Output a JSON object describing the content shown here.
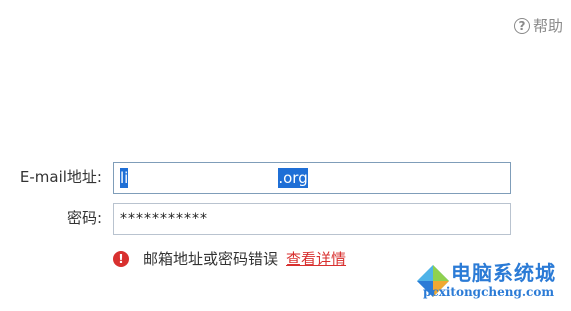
{
  "help": {
    "icon": "question-circle-icon",
    "label": "帮助"
  },
  "form": {
    "email_label": "E-mail地址:",
    "email_value_prefix": "li",
    "email_value_suffix": ".org",
    "password_label": "密码:",
    "password_value": "***********"
  },
  "error": {
    "icon": "exclamation-circle-icon",
    "message": "邮箱地址或密码错误",
    "link": "查看详情",
    "color": "#d8302f"
  },
  "watermark": {
    "title": "电脑系统城",
    "url": "pcxitongcheng.com"
  },
  "colors": {
    "accent": "#1f6fd6",
    "error": "#d8302f"
  }
}
